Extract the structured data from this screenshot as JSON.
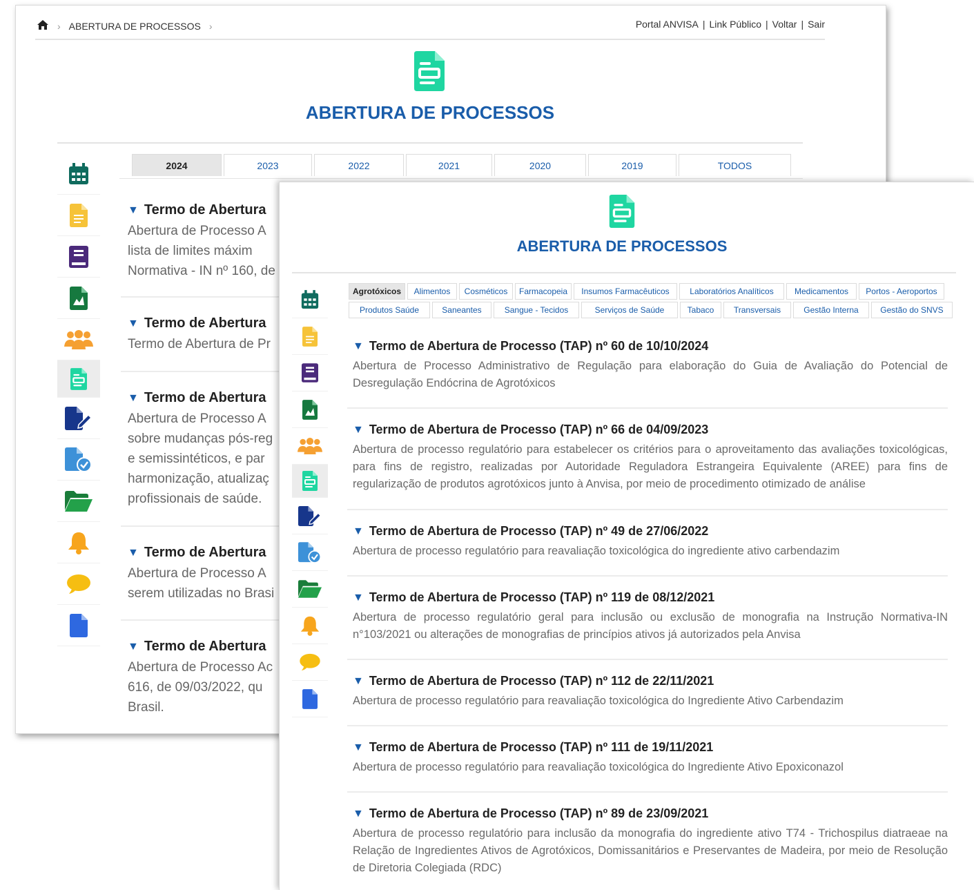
{
  "breadcrumb": {
    "home_icon": "home-icon",
    "current": "ABERTURA DE PROCESSOS"
  },
  "top_links": [
    "Portal ANVISA",
    "Link Público",
    "Voltar",
    "Sair"
  ],
  "page_title": "ABERTURA DE PROCESSOS",
  "colors": {
    "title": "#1a5daa",
    "doc_icon": "#1fd6a1",
    "tab_active_bg": "#e6e6e6"
  },
  "sidebar_icons": [
    "calendar-icon",
    "document-yellow-icon",
    "book-icon",
    "report-icon",
    "group-icon",
    "process-doc-icon",
    "edit-doc-icon",
    "file-check-icon",
    "folder-open-icon",
    "bell-icon",
    "chat-icon",
    "file-blue-icon"
  ],
  "year_tabs": [
    "2024",
    "2023",
    "2022",
    "2021",
    "2020",
    "2019",
    "TODOS"
  ],
  "back_items": [
    {
      "title": "Termo de Abertura",
      "desc": [
        "Abertura de Processo A",
        "lista de limites máxim",
        "Normativa - IN nº 160, de"
      ]
    },
    {
      "title": "Termo de Abertura",
      "desc": [
        "Termo de Abertura de Pr"
      ]
    },
    {
      "title": "Termo de Abertura",
      "desc": [
        "Abertura de Processo A",
        "sobre mudanças pós-reg",
        "e semissintéticos, e par",
        "harmonização, atualizaç",
        "profissionais de saúde."
      ]
    },
    {
      "title": "Termo de Abertura",
      "desc": [
        "Abertura de Processo A",
        "serem utilizadas no Brasi"
      ]
    },
    {
      "title": "Termo de Abertura",
      "desc": [
        "Abertura de Processo Ac",
        "616, de 09/03/2022, qu",
        "Brasil."
      ]
    }
  ],
  "category_tabs_row1": [
    "Agrotóxicos",
    "Alimentos",
    "Cosméticos",
    "Farmacopeia",
    "Insumos Farmacêuticos",
    "Laboratórios Analíticos",
    "Medicamentos",
    "Portos - Aeroportos"
  ],
  "category_tabs_row2": [
    "Produtos Saúde",
    "Saneantes",
    "Sangue - Tecidos",
    "Serviços de Saúde",
    "Tabaco",
    "Transversais",
    "Gestão Interna",
    "Gestão do SNVS"
  ],
  "items": [
    {
      "title": "Termo de Abertura de Processo (TAP) nº 60 de 10/10/2024",
      "desc": "Abertura de Processo Administrativo de Regulação para elaboração do Guia de Avaliação do Potencial de Desregulação Endócrina de Agrotóxicos"
    },
    {
      "title": "Termo de Abertura de Processo (TAP) nº 66 de 04/09/2023",
      "desc": "Abertura de processo regulatório para estabelecer os critérios para o aproveitamento das avaliações toxicológicas, para fins de registro, realizadas por Autoridade Reguladora Estrangeira Equivalente (AREE) para fins de regularização de produtos agrotóxicos junto à Anvisa, por meio de procedimento otimizado de análise"
    },
    {
      "title": "Termo de Abertura de Processo (TAP) nº 49 de 27/06/2022",
      "desc": "Abertura de processo regulatório para reavaliação toxicológica do ingrediente ativo carbendazim"
    },
    {
      "title": "Termo de Abertura de Processo (TAP) nº 119 de 08/12/2021",
      "desc": "Abertura de processo regulatório geral para inclusão ou exclusão de monografia na Instrução Normativa-IN n°103/2021 ou alterações de monografias de princípios ativos já autorizados pela Anvisa"
    },
    {
      "title": "Termo de Abertura de Processo (TAP) nº 112 de 22/11/2021",
      "desc": "Abertura de processo regulatório para reavaliação toxicológica do Ingrediente Ativo Carbendazim"
    },
    {
      "title": "Termo de Abertura de Processo (TAP) nº 111 de 19/11/2021",
      "desc": "Abertura de processo regulatório para reavaliação toxicológica do Ingrediente Ativo Epoxiconazol"
    },
    {
      "title": "Termo de Abertura de Processo (TAP) nº 89 de 23/09/2021",
      "desc": "Abertura de processo regulatório para inclusão da monografia do ingrediente ativo T74 - Trichospilus diatraeae na Relação de Ingredientes Ativos de Agrotóxicos, Domissanitários e Preservantes de Madeira, por meio de Resolução de Diretoria Colegiada (RDC)"
    }
  ]
}
